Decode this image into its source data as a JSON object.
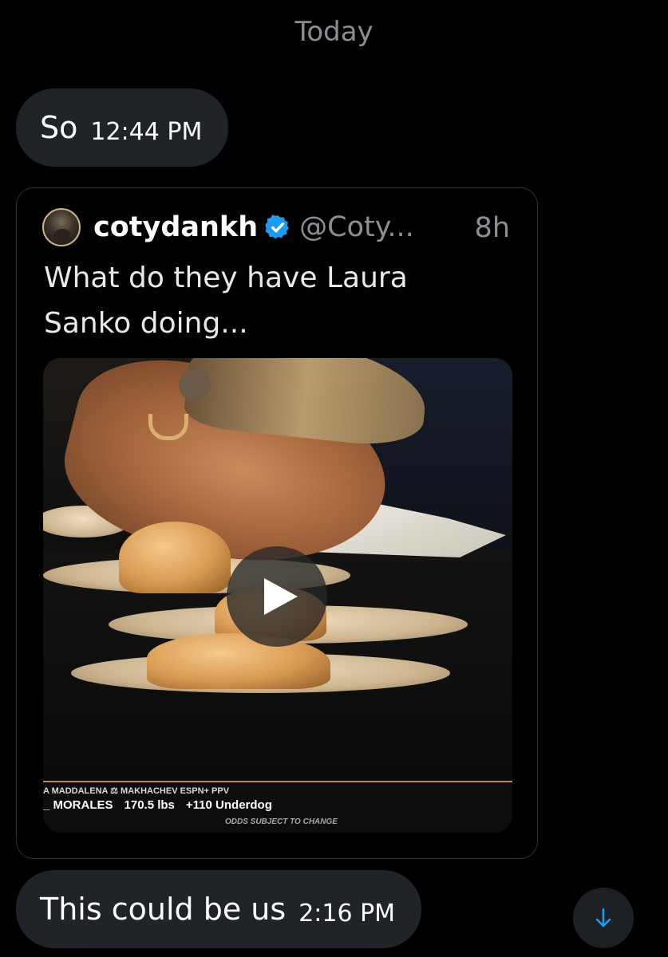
{
  "conversation": {
    "date_header": "Today",
    "messages": [
      {
        "text": "So",
        "time": "12:44 PM"
      },
      {
        "text": "This could be us",
        "time": "2:16 PM"
      }
    ]
  },
  "shared_post": {
    "display_name": "cotydankh",
    "handle": "@Coty...",
    "time": "8h",
    "text": "What do they have Laura Sanko doing...",
    "verified": true,
    "media": {
      "type": "video",
      "ticker_line1": "A MADDALENA ⚖ MAKHACHEV ESPN+ PPV",
      "ticker_fighter": "_ MORALES",
      "ticker_weight": "170.5 lbs",
      "ticker_odds": "+110 Underdog",
      "ticker_disclaimer": "ODDS SUBJECT TO CHANGE"
    }
  },
  "colors": {
    "background": "#000000",
    "bubble": "#202327",
    "verified_blue": "#1d9bf0",
    "secondary_text": "#8b8f94",
    "scroll_arrow": "#1d9bf0"
  },
  "icons": {
    "verified": "verified-badge-icon",
    "play": "play-icon",
    "scroll_down": "arrow-down-icon"
  }
}
